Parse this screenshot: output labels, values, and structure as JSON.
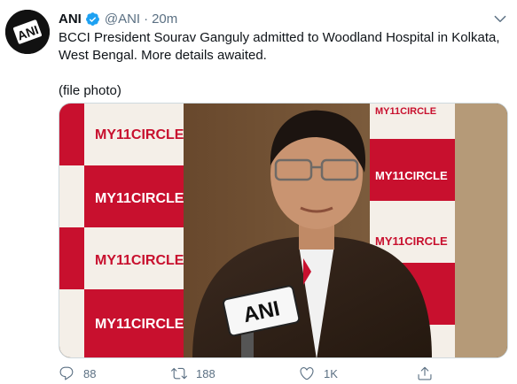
{
  "tweet": {
    "author_name": "ANI",
    "handle": "@ANI",
    "separator": "·",
    "time": "20m",
    "avatar_text": "ANI",
    "text_line1": "BCCI President Sourav Ganguly admitted to Woodland Hospital in Kolkata, West Bengal. More details awaited.",
    "text_line2": "(file photo)"
  },
  "media": {
    "banner_text": "MY11CIRCLE",
    "mic_label": "ANI"
  },
  "actions": {
    "reply_count": "88",
    "retweet_count": "188",
    "like_count": "1K"
  },
  "colors": {
    "verified": "#1da1f2",
    "secondary_text": "#5b7083",
    "banner_red": "#c8102e"
  },
  "icons": [
    "verified-badge-icon",
    "caret-down-icon",
    "reply-icon",
    "retweet-icon",
    "like-icon",
    "share-icon"
  ]
}
